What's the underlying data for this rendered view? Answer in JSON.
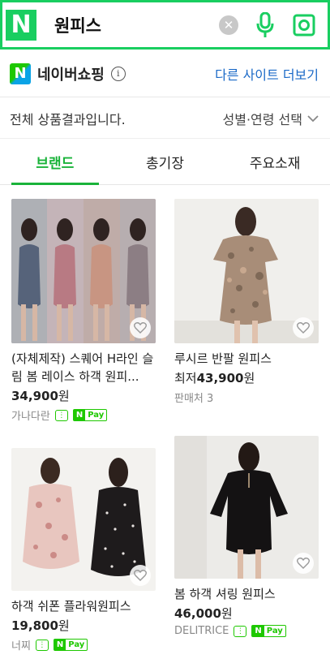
{
  "search": {
    "logo": "N",
    "query": "원피스"
  },
  "shopping": {
    "logo": "N",
    "title": "네이버쇼핑",
    "more_sites": "다른 사이트 더보기"
  },
  "filter": {
    "text": "전체 상품결과입니다.",
    "age_select": "성별·연령 선택"
  },
  "tabs": [
    {
      "label": "브랜드",
      "active": true
    },
    {
      "label": "총기장",
      "active": false
    },
    {
      "label": "주요소재",
      "active": false
    }
  ],
  "products": [
    {
      "title": "(자체제작) 스퀘어 H라인 슬림 봄 레이스 하객 원피...",
      "price": "34,900",
      "won": "원",
      "seller": "가나다란",
      "talk": true,
      "npay": true
    },
    {
      "title": "루시르 반팔 원피스",
      "price_prefix": "최저",
      "price": "43,900",
      "won": "원",
      "seller": "판매처 3",
      "talk": false,
      "npay": false
    },
    {
      "title": "하객 쉬폰 플라워원피스",
      "price": "19,800",
      "won": "원",
      "seller": "너찌",
      "talk": true,
      "npay": true
    },
    {
      "title": "봄 하객 셔링 원피스",
      "price": "46,000",
      "won": "원",
      "seller": "DELITRICE",
      "talk": true,
      "npay": true
    }
  ],
  "badges": {
    "npay_n": "N",
    "npay_pay": "Pay"
  },
  "colors": {
    "brand_green": "#19ce60",
    "link_blue": "#1a69c7",
    "active_tab": "#1ab33a"
  }
}
